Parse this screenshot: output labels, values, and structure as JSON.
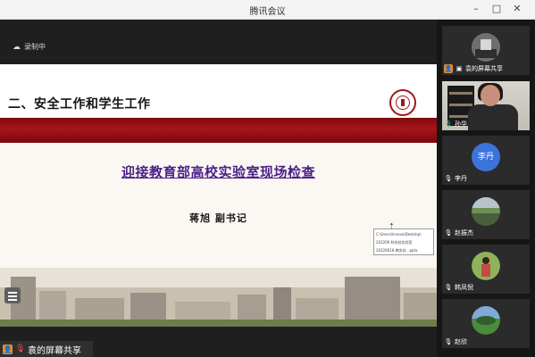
{
  "window": {
    "title": "腾讯会议"
  },
  "recording": {
    "label": "录制中"
  },
  "slide": {
    "heading": "二、安全工作和学生工作",
    "headline": "迎接教育部高校实验室现场检查",
    "speaker": "蒋旭  副书记"
  },
  "tooltip": {
    "lines": [
      "C:\\Users\\lenovo\\Desktop\\",
      "202206 科技处实验室",
      "20220618 教务处...pptx"
    ]
  },
  "share_bar": {
    "label": "袁的屏幕共享"
  },
  "participants": [
    {
      "label": "袁的屏幕共享",
      "type": "icon-avatar"
    },
    {
      "label": "孙华",
      "type": "video"
    },
    {
      "label": "李丹",
      "type": "text-avatar",
      "avatar_text": "李丹"
    },
    {
      "label": "赵振杰",
      "type": "avatar"
    },
    {
      "label": "韩凤倪",
      "type": "avatar"
    },
    {
      "label": "赵欣",
      "type": "avatar"
    }
  ],
  "colors": {
    "accent_red": "#a2161c",
    "headline_purple": "#4b1f86",
    "avatar_blue": "#3b73db",
    "mic_green": "#33d17a"
  }
}
